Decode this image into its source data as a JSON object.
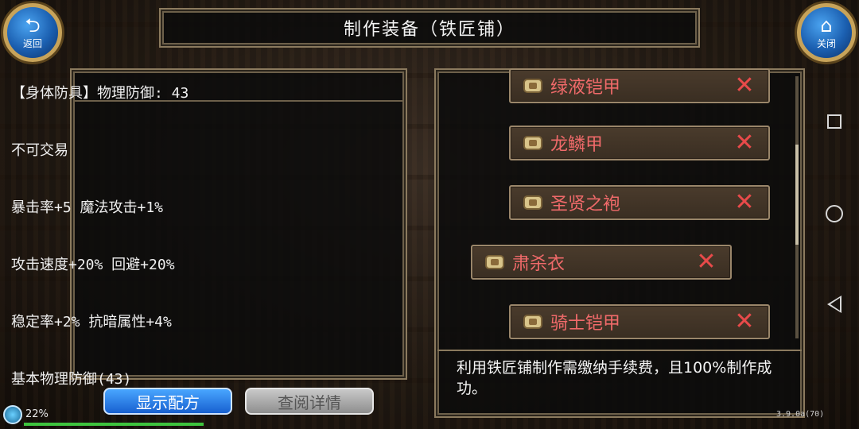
{
  "header": {
    "title": "制作装备（铁匠铺）"
  },
  "nav": {
    "back_label": "返回",
    "close_label": "关闭"
  },
  "item_info": {
    "lines": [
      "【身体防具】物理防御: 43",
      "不可交易",
      "暴击率+5 魔法攻击+1%",
      "攻击速度+20% 回避+20%",
      "稳定率+2% 抗暗属性+4%",
      "基本物理防御(43)"
    ]
  },
  "recipes": [
    {
      "name": "绿液铠甲"
    },
    {
      "name": "龙鳞甲"
    },
    {
      "name": "圣贤之袍"
    },
    {
      "name": "肃杀衣"
    },
    {
      "name": "骑士铠甲"
    }
  ],
  "recipe_list": {
    "scroll_position": 0.42
  },
  "fee_note": "利用铁匠铺制作需缴纳手续费，且100%制作成功。",
  "buttons": {
    "show_recipe": "显示配方",
    "view_detail": "查阅详情"
  },
  "status": {
    "battery": "22%",
    "version": "3.9.0a(70)"
  },
  "colors": {
    "recipe_name": "#f06a6a",
    "remove_icon": "#e84a4a",
    "primary_button": "#1f6fe0",
    "secondary_button": "#a0a0a0"
  }
}
